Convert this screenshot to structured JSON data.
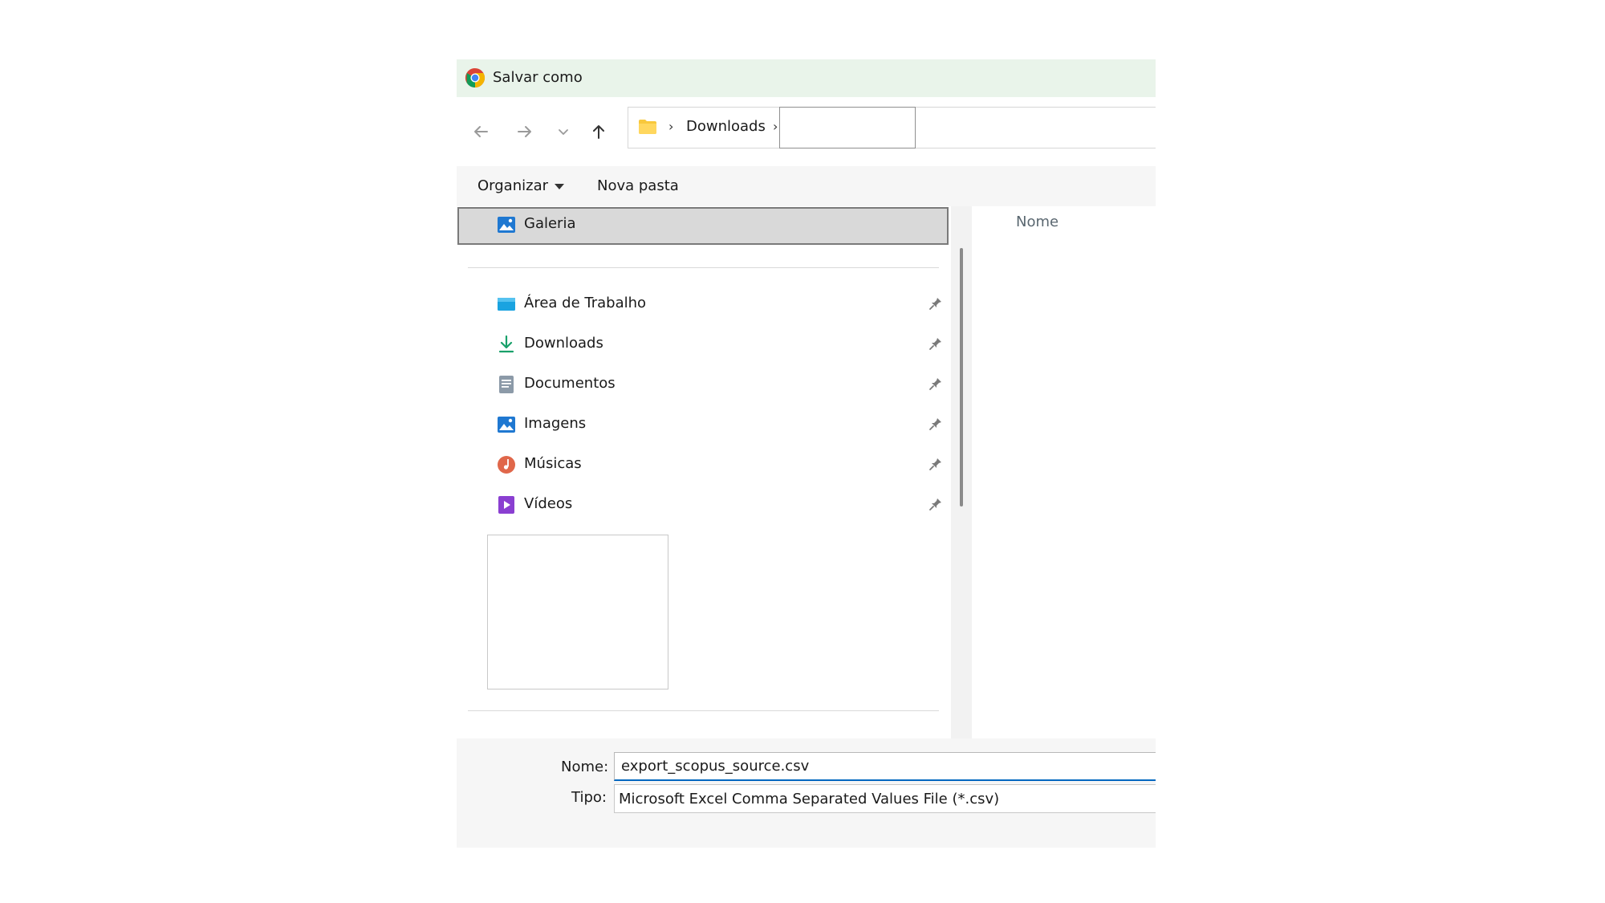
{
  "dialog": {
    "title": "Salvar como",
    "app_icon": "chrome-icon"
  },
  "navigation": {
    "back_icon": "arrow-left-icon",
    "forward_icon": "arrow-right-icon",
    "recent_icon": "chevron-down-icon",
    "up_icon": "arrow-up-icon",
    "address": {
      "folder_icon": "folder-icon",
      "separator": "›",
      "crumb": "Downloads",
      "edit_value": ""
    }
  },
  "commandbar": {
    "organize_label": "Organizar",
    "new_folder_label": "Nova pasta"
  },
  "sidebar": {
    "selected": {
      "label": "Galeria",
      "icon": "gallery-icon"
    },
    "items": [
      {
        "label": "Área de Trabalho",
        "icon": "desktop-icon",
        "pinned": true
      },
      {
        "label": "Downloads",
        "icon": "download-icon",
        "pinned": true
      },
      {
        "label": "Documentos",
        "icon": "document-icon",
        "pinned": true
      },
      {
        "label": "Imagens",
        "icon": "pictures-icon",
        "pinned": true
      },
      {
        "label": "Músicas",
        "icon": "music-icon",
        "pinned": true
      },
      {
        "label": "Vídeos",
        "icon": "video-icon",
        "pinned": true
      }
    ]
  },
  "content": {
    "column_header": "Nome"
  },
  "footer": {
    "name_label": "Nome:",
    "name_value": "export_scopus_source.csv",
    "type_label": "Tipo:",
    "type_value": "Microsoft Excel Comma Separated Values File (*.csv)"
  },
  "colors": {
    "titlebar_bg": "#e9f4ea",
    "accent": "#0067c0",
    "selection_bg": "#d9d9d9"
  }
}
